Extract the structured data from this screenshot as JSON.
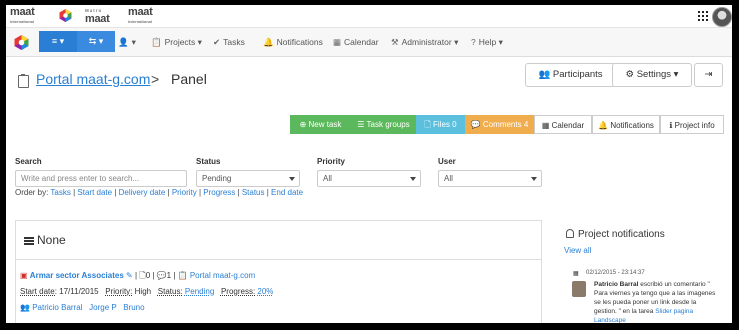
{
  "brand": {
    "logo1": "maat",
    "logo1_sub": "international",
    "logo2_small": "Matro",
    "logo2": "maat",
    "logo3": "maat",
    "logo3_sub": "international"
  },
  "nav": {
    "menu_icon": "≡ ▾",
    "share_icon": "⇆ ▾",
    "user_caret": "▾",
    "projects": "Projects",
    "tasks": "Tasks",
    "notifications": "Notifications",
    "calendar": "Calendar",
    "administrator": "Administrator",
    "help": "Help"
  },
  "page": {
    "project_link": "Portal maat-g.com",
    "separator": ">",
    "panel_title": "Panel"
  },
  "header_buttons": {
    "participants": "Participants",
    "settings": "Settings"
  },
  "toolbar": {
    "new_task": "New task",
    "task_groups": "Task groups",
    "files": "Files 0",
    "comments": "Comments 4",
    "calendar": "Calendar",
    "notifications": "Notifications",
    "project_info": "Project info"
  },
  "filters": {
    "search_label": "Search",
    "search_placeholder": "Write and press enter to search...",
    "status_label": "Status",
    "status_value": "Pending",
    "priority_label": "Priority",
    "priority_value": "All",
    "user_label": "User",
    "user_value": "All"
  },
  "order_by": {
    "label": "Order by:",
    "options": [
      "Tasks",
      "Start date",
      "Delivery date",
      "Priority",
      "Progress",
      "Status",
      "End date"
    ]
  },
  "task_list": {
    "group_title": "None",
    "task": {
      "name": "Armar sector Associates",
      "files_count": "0",
      "comments_count": "1",
      "project": "Portal maat-g.com",
      "start_date_label": "Start date:",
      "start_date": "17/11/2015",
      "priority_label": "Priority:",
      "priority": "High",
      "status_label": "Status:",
      "status": "Pending",
      "progress_label": "Progress:",
      "progress": "20%",
      "users": [
        "Patricio Barral",
        "Jorge P",
        "Bruno"
      ]
    }
  },
  "project_notifications": {
    "title": "Project notifications",
    "view_all": "View all",
    "items": [
      {
        "time": "02/12/2015 - 23:14:37",
        "author": "Patricio Barral",
        "text": " escribió un comentario \" Para viernes ya tengo que a las imagenes se les pueda poner un link desde la gestion. \" en la tarea ",
        "task_link": "Slider pagina Landscape"
      }
    ]
  },
  "colors": {
    "primary": "#2a7fd4",
    "green": "#5cb85c",
    "blue": "#5bc0de",
    "orange": "#f0ad4e"
  }
}
